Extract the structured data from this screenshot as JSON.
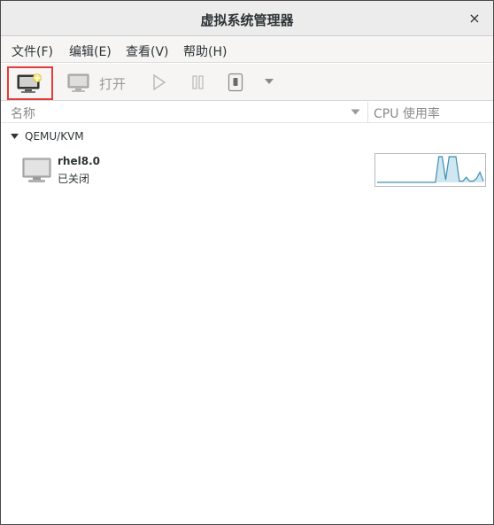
{
  "window": {
    "title": "虚拟系统管理器",
    "close_glyph": "×"
  },
  "menubar": {
    "items": [
      {
        "label": "文件(F)"
      },
      {
        "label": "编辑(E)"
      },
      {
        "label": "查看(V)"
      },
      {
        "label": "帮助(H)"
      }
    ]
  },
  "toolbar": {
    "new_vm_icon": "monitor-new-icon",
    "open_label": "打开",
    "run_icon": "play-icon",
    "pause_icon": "pause-icon",
    "shutdown_icon": "shutdown-icon",
    "dropdown_icon": "chevron-down-icon",
    "highlight_color": "#e03c3c"
  },
  "columns": {
    "name": "名称",
    "cpu": "CPU 使用率"
  },
  "connections": [
    {
      "name": "QEMU/KVM",
      "vms": [
        {
          "name": "rhel8.0",
          "status": "已关闭",
          "cpu_history": [
            0,
            0,
            0,
            0,
            0,
            0,
            0,
            0,
            0,
            0,
            0,
            0,
            0,
            0,
            0,
            0,
            0,
            0,
            1,
            1,
            0.1,
            1,
            1,
            1,
            0.05,
            0.05,
            0.2,
            0.05,
            0.05,
            0.15,
            0.4,
            0.05
          ]
        }
      ]
    }
  ],
  "colors": {
    "graph_line": "#3d8fb0",
    "graph_fill": "#cfe7f1",
    "accent": "#e03c3c"
  }
}
